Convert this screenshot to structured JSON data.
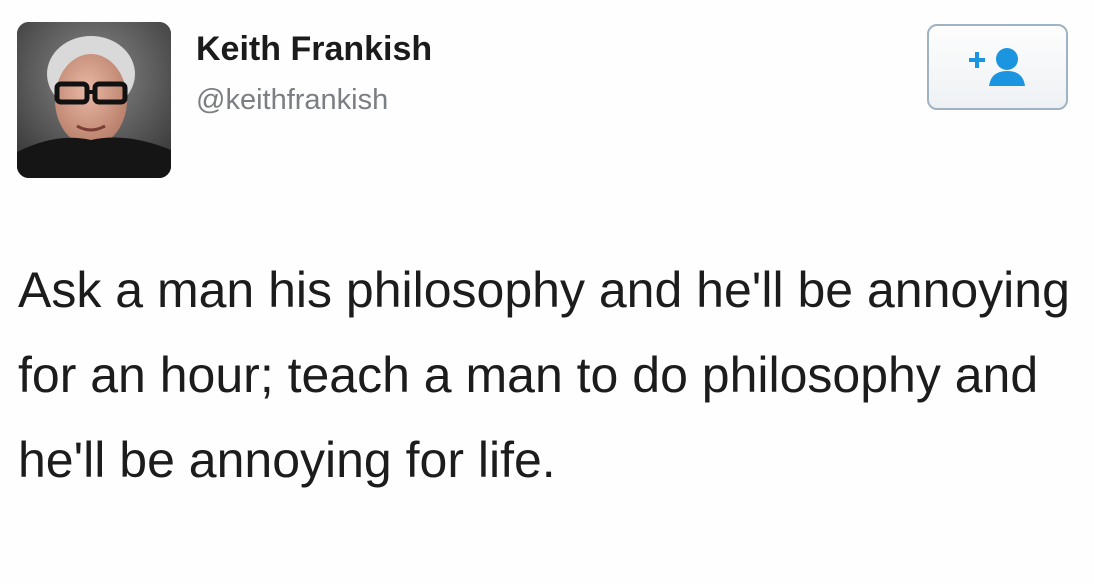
{
  "tweet": {
    "author_name": "Keith Frankish",
    "author_handle": "@keithfrankish",
    "text": "Ask a man his philosophy and he'll be annoying for an hour; teach a man to do philosophy and he'll be annoying for life.",
    "follow_icon": "add-user-icon"
  },
  "colors": {
    "follow_accent": "#1b95e0",
    "handle_gray": "#7b7e82"
  }
}
